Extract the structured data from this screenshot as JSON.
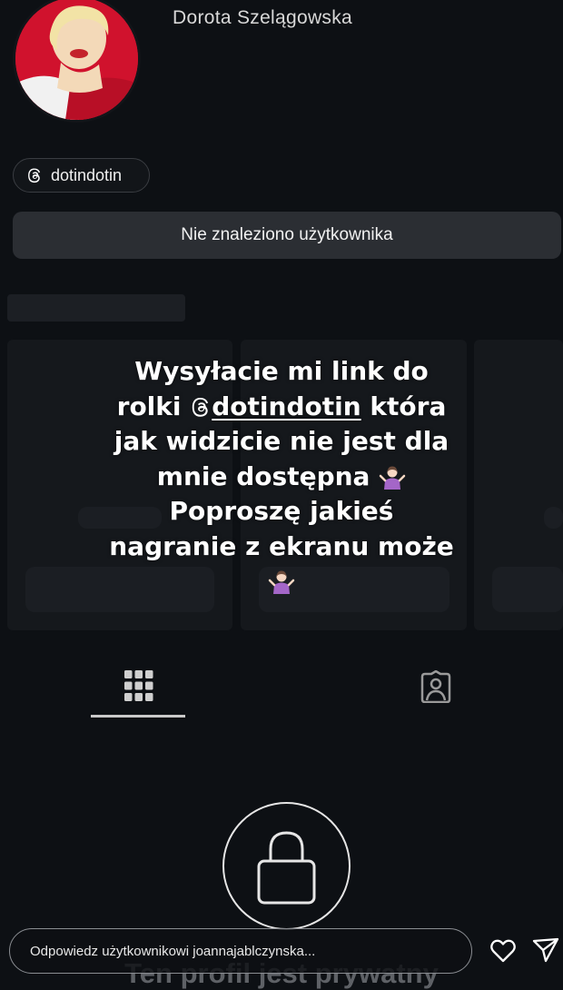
{
  "profile": {
    "name": "Dorota Szelągowska",
    "threads_handle": "dotindotin",
    "not_found_button": "Nie znaleziono użytkownika"
  },
  "story": {
    "lines": [
      "Wysyłacie mi link do",
      "rolki",
      "dotindotin",
      "która",
      "jak widzicie nie jest dla",
      "mnie dostępna",
      "Poproszę jakieś",
      "nagranie z ekranu może"
    ]
  },
  "tabs": [
    "grid-icon",
    "tagged-icon"
  ],
  "private": {
    "icon": "lock-icon",
    "message": "Ten profil jest prywatny"
  },
  "reply": {
    "placeholder": "Odpowiedz użytkownikowi joannajablczynska..."
  },
  "colors": {
    "background": "#0d1014",
    "button_bg": "#2b2e33",
    "avatar_bg": "#c8102e"
  }
}
